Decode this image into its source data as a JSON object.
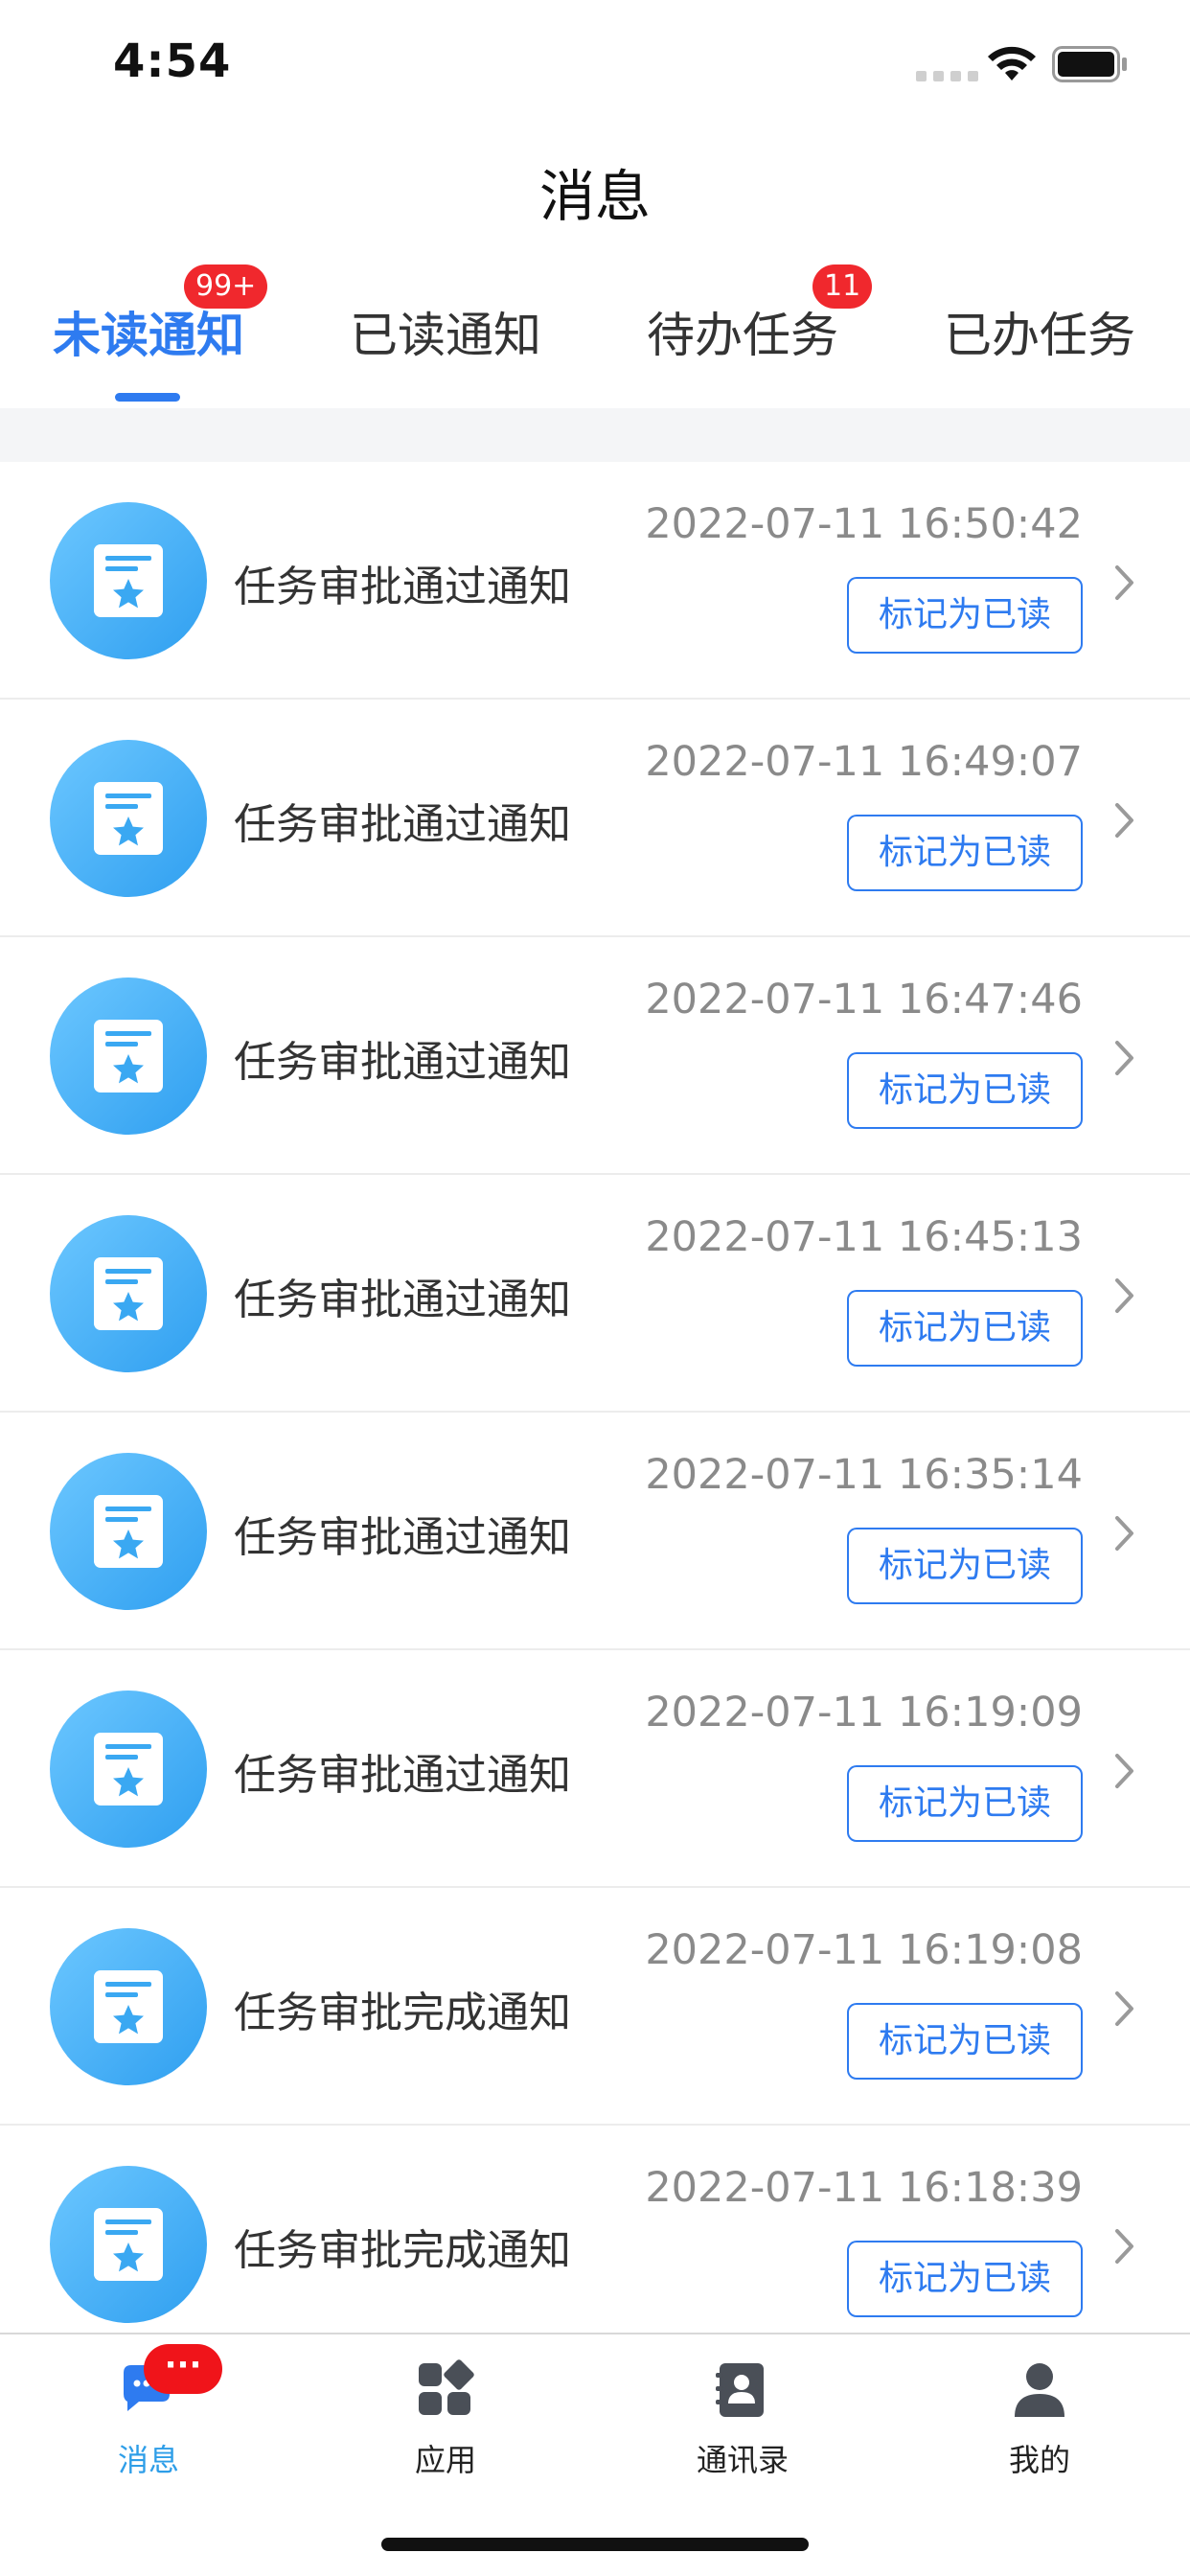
{
  "status_bar": {
    "time": "4:54"
  },
  "header": {
    "title": "消息"
  },
  "tabs": [
    {
      "label": "未读通知",
      "badge": "99+",
      "active": true
    },
    {
      "label": "已读通知",
      "badge": "",
      "active": false
    },
    {
      "label": "待办任务",
      "badge": "11",
      "active": false
    },
    {
      "label": "已办任务",
      "badge": "",
      "active": false
    }
  ],
  "notifications": [
    {
      "title": "任务审批通过通知",
      "time": "2022-07-11 16:50:42",
      "action": "标记为已读",
      "icon": "certificate-star-icon"
    },
    {
      "title": "任务审批通过通知",
      "time": "2022-07-11 16:49:07",
      "action": "标记为已读",
      "icon": "certificate-star-icon"
    },
    {
      "title": "任务审批通过通知",
      "time": "2022-07-11 16:47:46",
      "action": "标记为已读",
      "icon": "certificate-star-icon"
    },
    {
      "title": "任务审批通过通知",
      "time": "2022-07-11 16:45:13",
      "action": "标记为已读",
      "icon": "certificate-star-icon"
    },
    {
      "title": "任务审批通过通知",
      "time": "2022-07-11 16:35:14",
      "action": "标记为已读",
      "icon": "certificate-star-icon"
    },
    {
      "title": "任务审批通过通知",
      "time": "2022-07-11 16:19:09",
      "action": "标记为已读",
      "icon": "certificate-star-icon"
    },
    {
      "title": "任务审批完成通知",
      "time": "2022-07-11 16:19:08",
      "action": "标记为已读",
      "icon": "certificate-star-icon"
    },
    {
      "title": "任务审批完成通知",
      "time": "2022-07-11 16:18:39",
      "action": "标记为已读",
      "icon": "certificate-star-icon"
    }
  ],
  "bottom_nav": {
    "items": [
      {
        "label": "消息",
        "icon": "chat-bubble-icon",
        "active": true,
        "badge": "···"
      },
      {
        "label": "应用",
        "icon": "apps-grid-icon",
        "active": false
      },
      {
        "label": "通讯录",
        "icon": "contacts-book-icon",
        "active": false
      },
      {
        "label": "我的",
        "icon": "person-icon",
        "active": false
      }
    ]
  },
  "colors": {
    "accent": "#2e7bf0",
    "badge": "#f0282d",
    "avatar": "#3aa8f2",
    "nav_active": "#2e9ee8"
  }
}
